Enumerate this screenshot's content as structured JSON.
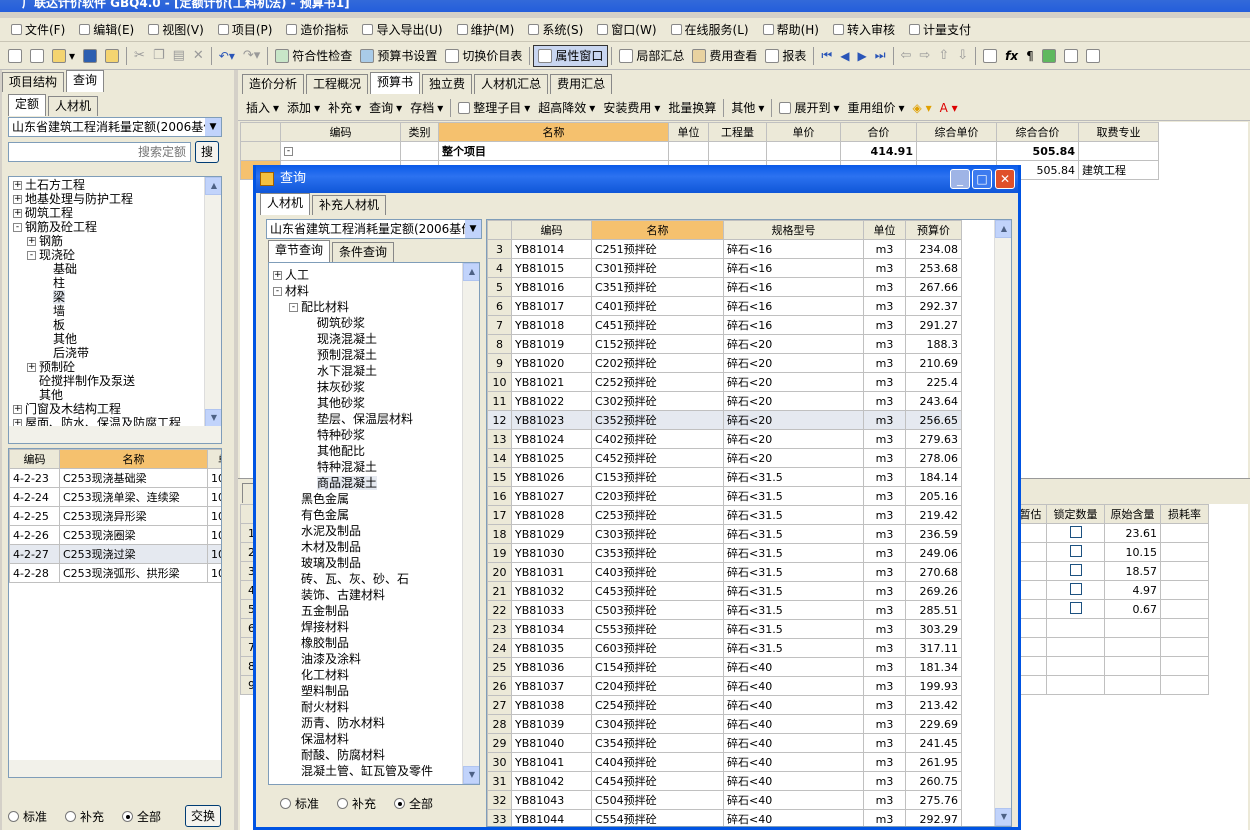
{
  "app": {
    "title": "广联达计价软件 GBQ4.0 - [定额计价(工料机法) - 预算书1]"
  },
  "menu": [
    "文件(F)",
    "编辑(E)",
    "视图(V)",
    "项目(P)",
    "造价指标",
    "导入导出(U)",
    "维护(M)",
    "系统(S)",
    "窗口(W)",
    "在线服务(L)",
    "帮助(H)",
    "转入审核",
    "计量支付"
  ],
  "toolbar": {
    "check": "符合性检查",
    "settings": "预算书设置",
    "switch": "切换价目表",
    "props": "属性窗口",
    "local": "局部汇总",
    "fee": "费用查看",
    "report": "报表"
  },
  "left": {
    "tabs": [
      "项目结构",
      "查询"
    ],
    "subtabs": [
      "定额",
      "人材机"
    ],
    "quota_select": "山东省建筑工程消耗量定额(2006基价)",
    "search_placeholder": "搜索定额",
    "search_btn": "搜",
    "tree": [
      {
        "t": "土石方工程",
        "d": 0,
        "e": "+"
      },
      {
        "t": "地基处理与防护工程",
        "d": 0,
        "e": "+"
      },
      {
        "t": "砌筑工程",
        "d": 0,
        "e": "+"
      },
      {
        "t": "钢筋及砼工程",
        "d": 0,
        "e": "-"
      },
      {
        "t": "钢筋",
        "d": 1,
        "e": "+"
      },
      {
        "t": "现浇砼",
        "d": 1,
        "e": "-"
      },
      {
        "t": "基础",
        "d": 2,
        "e": ""
      },
      {
        "t": "柱",
        "d": 2,
        "e": ""
      },
      {
        "t": "梁",
        "d": 2,
        "e": ""
      },
      {
        "t": "墙",
        "d": 2,
        "e": ""
      },
      {
        "t": "板",
        "d": 2,
        "e": ""
      },
      {
        "t": "其他",
        "d": 2,
        "e": ""
      },
      {
        "t": "后浇带",
        "d": 2,
        "e": ""
      },
      {
        "t": "预制砼",
        "d": 1,
        "e": "+"
      },
      {
        "t": "砼搅拌制作及泵送",
        "d": 1,
        "e": ""
      },
      {
        "t": "其他",
        "d": 1,
        "e": ""
      },
      {
        "t": "门窗及木结构工程",
        "d": 0,
        "e": "+"
      },
      {
        "t": "屋面、防水、保温及防腐工程",
        "d": 0,
        "e": "+"
      }
    ],
    "grid_headers": [
      "编码",
      "名称",
      "单"
    ],
    "grid": [
      [
        "4-2-23",
        "C253现浇基础梁",
        "10m"
      ],
      [
        "4-2-24",
        "C253现浇单梁、连续梁",
        "10m"
      ],
      [
        "4-2-25",
        "C253现浇异形梁",
        "10m"
      ],
      [
        "4-2-26",
        "C253现浇圈梁",
        "10m"
      ],
      [
        "4-2-27",
        "C253现浇过梁",
        "10m"
      ],
      [
        "4-2-28",
        "C253现浇弧形、拱形梁",
        "10m"
      ]
    ],
    "radios": [
      "标准",
      "补充",
      "全部"
    ],
    "exchange": "交换"
  },
  "right": {
    "tabs": [
      "造价分析",
      "工程概况",
      "预算书",
      "独立费",
      "人材机汇总",
      "费用汇总"
    ],
    "subtoolbar": [
      "插入",
      "添加",
      "补充",
      "查询",
      "存档",
      "整理子目",
      "超高降效",
      "安装费用",
      "批量换算",
      "其他",
      "展开到",
      "重用组价"
    ],
    "headers": [
      "编码",
      "类别",
      "名称",
      "单位",
      "工程量",
      "单价",
      "合价",
      "综合单价",
      "综合合价",
      "取费专业"
    ],
    "row1": {
      "name": "整个项目",
      "total": "414.91",
      "comp": "505.84"
    },
    "row2": {
      "comp": "505.84",
      "major": "建筑工程"
    },
    "lower_headers": [
      "暂估",
      "锁定数量",
      "原始含量",
      "损耗率"
    ],
    "lower": [
      "23.61",
      "10.15",
      "18.57",
      "4.97",
      "0.67"
    ],
    "lower_rn": [
      "1",
      "2",
      "3",
      "4",
      "5",
      "6",
      "7",
      "8",
      "9"
    ]
  },
  "dialog": {
    "title": "查询",
    "tabs": [
      "人材机",
      "补充人材机"
    ],
    "select": "山东省建筑工程消耗量定额(2006基价)",
    "subtabs": [
      "章节查询",
      "条件查询"
    ],
    "tree": [
      {
        "t": "人工",
        "d": 0,
        "e": "+"
      },
      {
        "t": "材料",
        "d": 0,
        "e": "-"
      },
      {
        "t": "配比材料",
        "d": 1,
        "e": "-"
      },
      {
        "t": "砌筑砂浆",
        "d": 2
      },
      {
        "t": "现浇混凝土",
        "d": 2
      },
      {
        "t": "预制混凝土",
        "d": 2
      },
      {
        "t": "水下混凝土",
        "d": 2
      },
      {
        "t": "抹灰砂浆",
        "d": 2
      },
      {
        "t": "其他砂浆",
        "d": 2
      },
      {
        "t": "垫层、保温层材料",
        "d": 2
      },
      {
        "t": "特种砂浆",
        "d": 2
      },
      {
        "t": "其他配比",
        "d": 2
      },
      {
        "t": "特种混凝土",
        "d": 2
      },
      {
        "t": "商品混凝土",
        "d": 2
      },
      {
        "t": "黑色金属",
        "d": 1
      },
      {
        "t": "有色金属",
        "d": 1
      },
      {
        "t": "水泥及制品",
        "d": 1
      },
      {
        "t": "木材及制品",
        "d": 1
      },
      {
        "t": "玻璃及制品",
        "d": 1
      },
      {
        "t": "砖、瓦、灰、砂、石",
        "d": 1
      },
      {
        "t": "装饰、古建材料",
        "d": 1
      },
      {
        "t": "五金制品",
        "d": 1
      },
      {
        "t": "焊接材料",
        "d": 1
      },
      {
        "t": "橡胶制品",
        "d": 1
      },
      {
        "t": "油漆及涂料",
        "d": 1
      },
      {
        "t": "化工材料",
        "d": 1
      },
      {
        "t": "塑料制品",
        "d": 1
      },
      {
        "t": "耐火材料",
        "d": 1
      },
      {
        "t": "沥青、防水材料",
        "d": 1
      },
      {
        "t": "保温材料",
        "d": 1
      },
      {
        "t": "耐酸、防腐材料",
        "d": 1
      },
      {
        "t": "混凝土管、缸瓦管及零件",
        "d": 1
      }
    ],
    "radios": [
      "标准",
      "补充",
      "全部"
    ],
    "headers": [
      "编码",
      "名称",
      "规格型号",
      "单位",
      "预算价"
    ],
    "rows": [
      [
        "3",
        "YB81014",
        "C251预拌砼",
        "碎石<16",
        "m3",
        "234.08"
      ],
      [
        "4",
        "YB81015",
        "C301预拌砼",
        "碎石<16",
        "m3",
        "253.68"
      ],
      [
        "5",
        "YB81016",
        "C351预拌砼",
        "碎石<16",
        "m3",
        "267.66"
      ],
      [
        "6",
        "YB81017",
        "C401预拌砼",
        "碎石<16",
        "m3",
        "292.37"
      ],
      [
        "7",
        "YB81018",
        "C451预拌砼",
        "碎石<16",
        "m3",
        "291.27"
      ],
      [
        "8",
        "YB81019",
        "C152预拌砼",
        "碎石<20",
        "m3",
        "188.3"
      ],
      [
        "9",
        "YB81020",
        "C202预拌砼",
        "碎石<20",
        "m3",
        "210.69"
      ],
      [
        "10",
        "YB81021",
        "C252预拌砼",
        "碎石<20",
        "m3",
        "225.4"
      ],
      [
        "11",
        "YB81022",
        "C302预拌砼",
        "碎石<20",
        "m3",
        "243.64"
      ],
      [
        "12",
        "YB81023",
        "C352预拌砼",
        "碎石<20",
        "m3",
        "256.65"
      ],
      [
        "13",
        "YB81024",
        "C402预拌砼",
        "碎石<20",
        "m3",
        "279.63"
      ],
      [
        "14",
        "YB81025",
        "C452预拌砼",
        "碎石<20",
        "m3",
        "278.06"
      ],
      [
        "15",
        "YB81026",
        "C153预拌砼",
        "碎石<31.5",
        "m3",
        "184.14"
      ],
      [
        "16",
        "YB81027",
        "C203预拌砼",
        "碎石<31.5",
        "m3",
        "205.16"
      ],
      [
        "17",
        "YB81028",
        "C253预拌砼",
        "碎石<31.5",
        "m3",
        "219.42"
      ],
      [
        "18",
        "YB81029",
        "C303预拌砼",
        "碎石<31.5",
        "m3",
        "236.59"
      ],
      [
        "19",
        "YB81030",
        "C353预拌砼",
        "碎石<31.5",
        "m3",
        "249.06"
      ],
      [
        "20",
        "YB81031",
        "C403预拌砼",
        "碎石<31.5",
        "m3",
        "270.68"
      ],
      [
        "21",
        "YB81032",
        "C453预拌砼",
        "碎石<31.5",
        "m3",
        "269.26"
      ],
      [
        "22",
        "YB81033",
        "C503预拌砼",
        "碎石<31.5",
        "m3",
        "285.51"
      ],
      [
        "23",
        "YB81034",
        "C553预拌砼",
        "碎石<31.5",
        "m3",
        "303.29"
      ],
      [
        "24",
        "YB81035",
        "C603预拌砼",
        "碎石<31.5",
        "m3",
        "317.11"
      ],
      [
        "25",
        "YB81036",
        "C154预拌砼",
        "碎石<40",
        "m3",
        "181.34"
      ],
      [
        "26",
        "YB81037",
        "C204预拌砼",
        "碎石<40",
        "m3",
        "199.93"
      ],
      [
        "27",
        "YB81038",
        "C254预拌砼",
        "碎石<40",
        "m3",
        "213.42"
      ],
      [
        "28",
        "YB81039",
        "C304预拌砼",
        "碎石<40",
        "m3",
        "229.69"
      ],
      [
        "29",
        "YB81040",
        "C354预拌砼",
        "碎石<40",
        "m3",
        "241.45"
      ],
      [
        "30",
        "YB81041",
        "C404预拌砼",
        "碎石<40",
        "m3",
        "261.95"
      ],
      [
        "31",
        "YB81042",
        "C454预拌砼",
        "碎石<40",
        "m3",
        "260.75"
      ],
      [
        "32",
        "YB81043",
        "C504预拌砼",
        "碎石<40",
        "m3",
        "275.76"
      ],
      [
        "33",
        "YB81044",
        "C554预拌砼",
        "碎石<40",
        "m3",
        "292.97"
      ]
    ]
  }
}
